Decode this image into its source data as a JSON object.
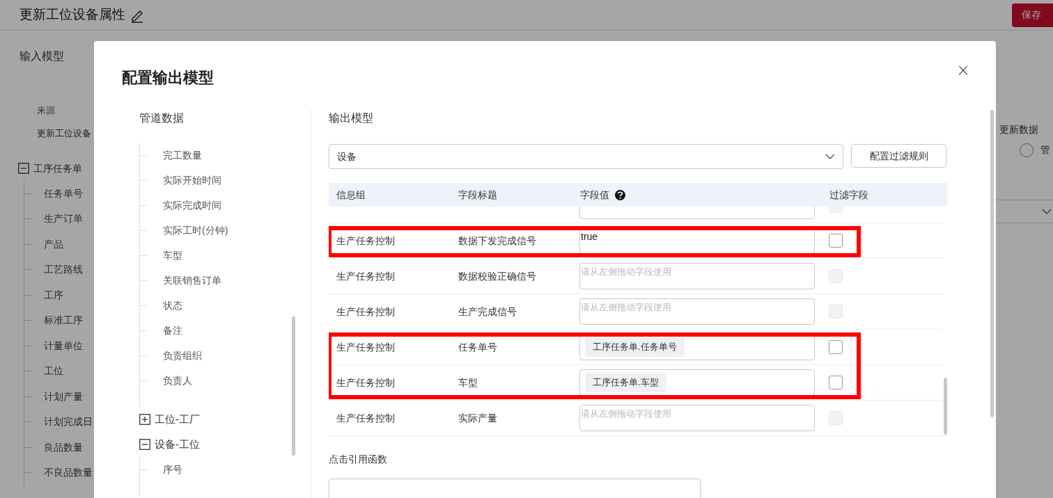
{
  "page": {
    "title": "更新工位设备属性",
    "save_button": "保存",
    "input_model_heading": "输入模型",
    "source_label": "来源",
    "source_value": "更新工位设备",
    "tree": [
      {
        "label": "工序任务单",
        "expanded": true,
        "children": [
          {
            "label": "任务单号"
          },
          {
            "label": "生产订单"
          },
          {
            "label": "产品"
          },
          {
            "label": "工艺路线"
          },
          {
            "label": "工序"
          },
          {
            "label": "标准工序"
          },
          {
            "label": "计量单位"
          },
          {
            "label": "工位"
          },
          {
            "label": "计划产量"
          },
          {
            "label": "计划完成日"
          },
          {
            "label": "良品数量"
          },
          {
            "label": "不良品数量"
          }
        ]
      }
    ],
    "right_heading": "更新数据",
    "radio": {
      "label": "管",
      "selected": false
    }
  },
  "dialog": {
    "title": "配置输出模型",
    "close": "×",
    "pipeline_heading": "管道数据",
    "pipeline_tree": [
      {
        "children": [
          {
            "label": "完工数量"
          },
          {
            "label": "实际开始时间"
          },
          {
            "label": "实际完成时间"
          },
          {
            "label": "实际工时(分钟)"
          },
          {
            "label": "车型"
          },
          {
            "label": "关联销售订单"
          },
          {
            "label": "状态"
          },
          {
            "label": "备注"
          },
          {
            "label": "负责组织"
          },
          {
            "label": "负责人"
          }
        ]
      },
      {
        "label": "工位-工厂",
        "expanded": false
      },
      {
        "label": "设备-工位",
        "expanded": true,
        "children": [
          {
            "label": "序号"
          }
        ]
      }
    ],
    "output_heading": "输出模型",
    "model_select": {
      "value": "设备"
    },
    "filter_button": "配置过滤规则",
    "table": {
      "columns": [
        {
          "label": "信息组",
          "help": false
        },
        {
          "label": "字段标题",
          "help": false
        },
        {
          "label": "字段值",
          "help": true
        },
        {
          "label": "过滤字段",
          "help": false
        }
      ],
      "rows": [
        {
          "kind": "cut_off",
          "disabled": true,
          "checked": false,
          "highlighted": false
        },
        {
          "kind": "full",
          "group": "生产任务控制",
          "title": "数据下发完成信号",
          "value": {
            "kind": "text",
            "text": "true"
          },
          "disabled": false,
          "checked": false,
          "highlighted": true
        },
        {
          "kind": "full",
          "group": "生产任务控制",
          "title": "数据校验正确信号",
          "value": {
            "kind": "empty",
            "placeholder": "请从左侧拖动字段使用"
          },
          "disabled": true,
          "checked": false,
          "highlighted": false
        },
        {
          "kind": "full",
          "group": "生产任务控制",
          "title": "生产完成信号",
          "value": {
            "kind": "empty",
            "placeholder": "请从左侧拖动字段使用"
          },
          "disabled": true,
          "checked": false,
          "highlighted": false
        },
        {
          "kind": "full",
          "group": "生产任务控制",
          "title": "任务单号",
          "value": {
            "kind": "tag",
            "text": "工序任务单.任务单号"
          },
          "disabled": false,
          "checked": false,
          "highlighted": true
        },
        {
          "kind": "full",
          "group": "生产任务控制",
          "title": "车型",
          "value": {
            "kind": "tag",
            "text": "工序任务单.车型"
          },
          "disabled": false,
          "checked": false,
          "highlighted": true
        },
        {
          "kind": "full",
          "group": "生产任务控制",
          "title": "实际产量",
          "value": {
            "kind": "empty",
            "placeholder": "请从左侧拖动字段使用"
          },
          "disabled": true,
          "checked": false,
          "highlighted": false
        }
      ]
    },
    "function_heading": "点击引用函数"
  }
}
